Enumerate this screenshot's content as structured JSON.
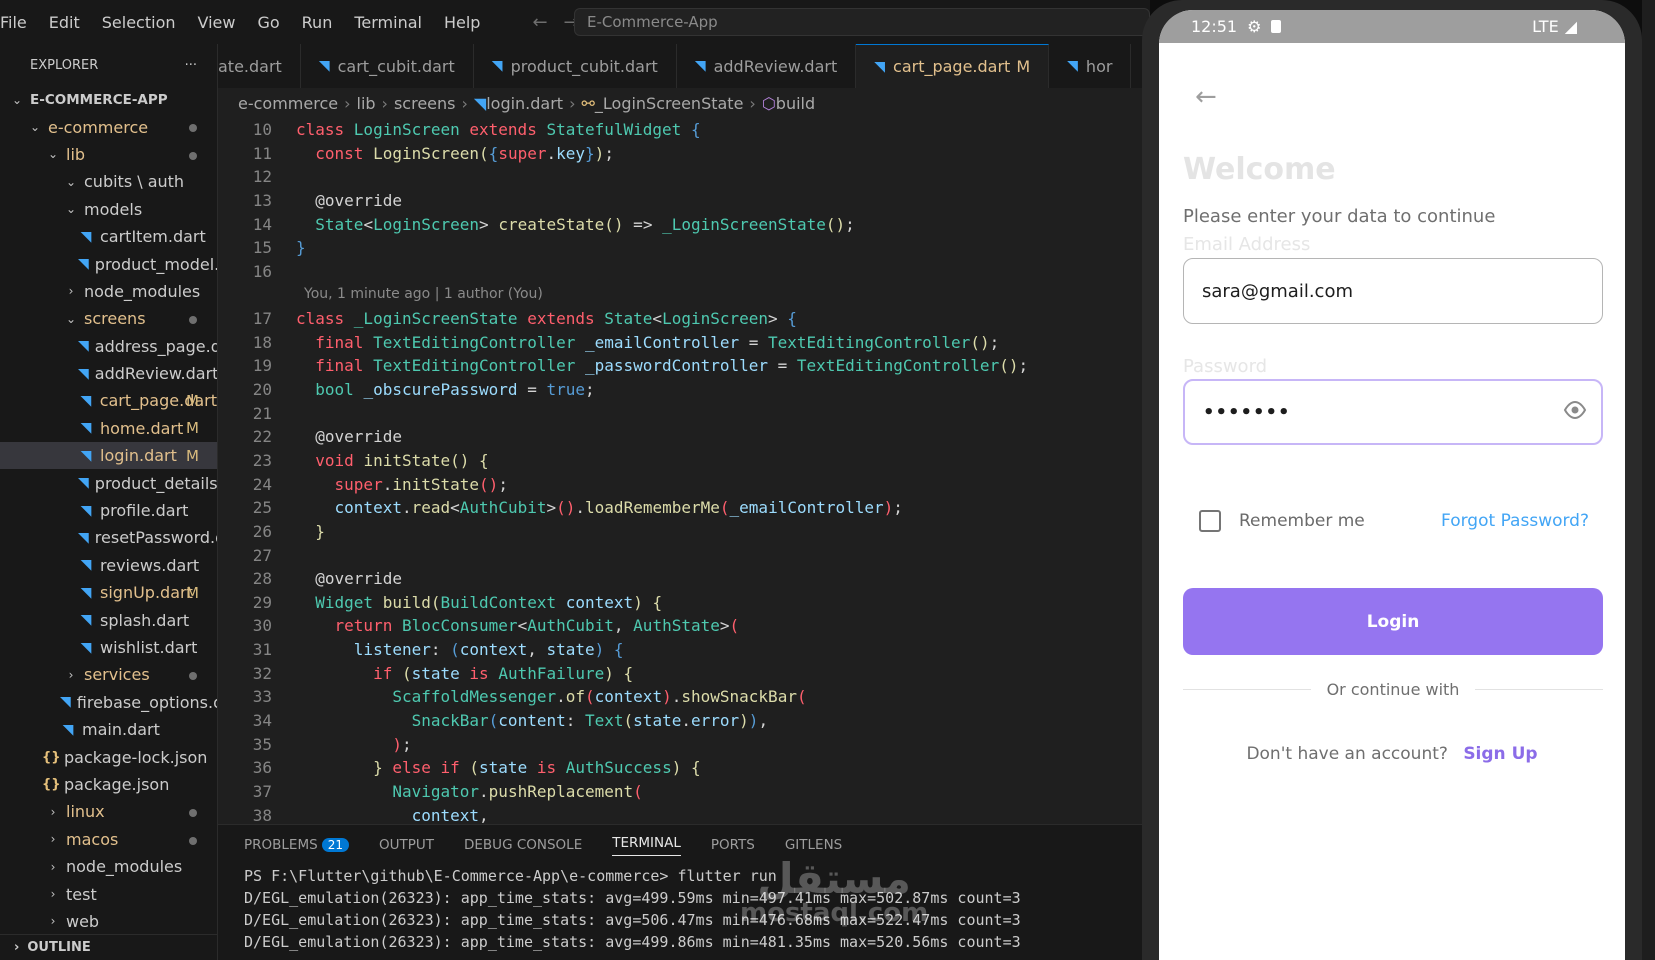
{
  "menubar": {
    "items": [
      "File",
      "Edit",
      "Selection",
      "View",
      "Go",
      "Run",
      "Terminal",
      "Help"
    ],
    "search_text": "E-Commerce-App"
  },
  "sidebar": {
    "header": "EXPLORER",
    "more": "···",
    "tree": [
      {
        "label": "E-COMMERCE-APP",
        "indent": 0,
        "type": "root-open",
        "badge": ""
      },
      {
        "label": "e-commerce",
        "indent": 1,
        "type": "folder-open",
        "badge": "dot",
        "modified": true
      },
      {
        "label": "lib",
        "indent": 2,
        "type": "folder-open",
        "badge": "dot",
        "modified": true
      },
      {
        "label": "cubits \\ auth",
        "indent": 3,
        "type": "folder-open",
        "badge": ""
      },
      {
        "label": "models",
        "indent": 3,
        "type": "folder-open",
        "badge": ""
      },
      {
        "label": "cartItem.dart",
        "indent": 4,
        "type": "dart",
        "badge": ""
      },
      {
        "label": "product_model.dart",
        "indent": 4,
        "type": "dart",
        "badge": ""
      },
      {
        "label": "node_modules",
        "indent": 3,
        "type": "folder-closed",
        "badge": ""
      },
      {
        "label": "screens",
        "indent": 3,
        "type": "folder-open",
        "badge": "dot",
        "modified": true
      },
      {
        "label": "address_page.dart",
        "indent": 4,
        "type": "dart",
        "badge": ""
      },
      {
        "label": "addReview.dart",
        "indent": 4,
        "type": "dart",
        "badge": ""
      },
      {
        "label": "cart_page.dart",
        "indent": 4,
        "type": "dart",
        "badge": "M",
        "modified": true
      },
      {
        "label": "home.dart",
        "indent": 4,
        "type": "dart",
        "badge": "M",
        "modified": true
      },
      {
        "label": "login.dart",
        "indent": 4,
        "type": "dart",
        "badge": "M",
        "modified": true,
        "selected": true
      },
      {
        "label": "product_details.dart",
        "indent": 4,
        "type": "dart",
        "badge": ""
      },
      {
        "label": "profile.dart",
        "indent": 4,
        "type": "dart",
        "badge": ""
      },
      {
        "label": "resetPassword.dart",
        "indent": 4,
        "type": "dart",
        "badge": ""
      },
      {
        "label": "reviews.dart",
        "indent": 4,
        "type": "dart",
        "badge": ""
      },
      {
        "label": "signUp.dart",
        "indent": 4,
        "type": "dart",
        "badge": "M",
        "modified": true
      },
      {
        "label": "splash.dart",
        "indent": 4,
        "type": "dart",
        "badge": ""
      },
      {
        "label": "wishlist.dart",
        "indent": 4,
        "type": "dart",
        "badge": ""
      },
      {
        "label": "services",
        "indent": 3,
        "type": "folder-closed",
        "badge": "dot",
        "modified": true
      },
      {
        "label": "firebase_options.dart",
        "indent": 3,
        "type": "dart",
        "badge": ""
      },
      {
        "label": "main.dart",
        "indent": 3,
        "type": "dart",
        "badge": ""
      },
      {
        "label": "package-lock.json",
        "indent": 2,
        "type": "json",
        "badge": ""
      },
      {
        "label": "package.json",
        "indent": 2,
        "type": "json",
        "badge": ""
      },
      {
        "label": "linux",
        "indent": 2,
        "type": "folder-closed",
        "badge": "dot",
        "modified": true
      },
      {
        "label": "macos",
        "indent": 2,
        "type": "folder-closed",
        "badge": "dot",
        "modified": true
      },
      {
        "label": "node_modules",
        "indent": 2,
        "type": "folder-closed",
        "badge": ""
      },
      {
        "label": "test",
        "indent": 2,
        "type": "folder-closed",
        "badge": ""
      },
      {
        "label": "web",
        "indent": 2,
        "type": "folder-closed",
        "badge": ""
      }
    ],
    "outline_label": "OUTLINE"
  },
  "tabs": [
    {
      "label": "ate.dart",
      "active": false,
      "badge": "",
      "icon": false
    },
    {
      "label": "cart_cubit.dart",
      "active": false,
      "badge": "",
      "icon": true
    },
    {
      "label": "product_cubit.dart",
      "active": false,
      "badge": "",
      "icon": true
    },
    {
      "label": "addReview.dart",
      "active": false,
      "badge": "",
      "icon": true
    },
    {
      "label": "cart_page.dart",
      "active": true,
      "badge": "M",
      "icon": true
    },
    {
      "label": "hor",
      "active": false,
      "badge": "",
      "icon": true
    }
  ],
  "breadcrumb": [
    "e-commerce",
    "lib",
    "screens",
    "login.dart",
    "_LoginScreenState",
    "build"
  ],
  "editor": {
    "blame": "You, 1 minute ago | 1 author (You)",
    "lines": [
      {
        "n": "10",
        "t": [
          [
            "kw",
            "class "
          ],
          [
            "ty",
            "LoginScreen "
          ],
          [
            "kw",
            "extends "
          ],
          [
            "ty",
            "StatefulWidget "
          ],
          [
            "lit",
            "{"
          ]
        ]
      },
      {
        "n": "11",
        "t": [
          [
            "an",
            "  "
          ],
          [
            "kw",
            "const "
          ],
          [
            "fn",
            "LoginScreen"
          ],
          [
            "fn",
            "("
          ],
          [
            "lit",
            "{"
          ],
          [
            "kw",
            "super"
          ],
          [
            "an",
            "."
          ],
          [
            "pr",
            "key"
          ],
          [
            "lit",
            "}"
          ],
          [
            "fn",
            ")"
          ],
          [
            "an",
            ";"
          ]
        ]
      },
      {
        "n": "12",
        "t": []
      },
      {
        "n": "13",
        "t": [
          [
            "an",
            "  @override"
          ]
        ]
      },
      {
        "n": "14",
        "t": [
          [
            "an",
            "  "
          ],
          [
            "ty",
            "State"
          ],
          [
            "an",
            "<"
          ],
          [
            "ty",
            "LoginScreen"
          ],
          [
            "an",
            "> "
          ],
          [
            "fn",
            "createState"
          ],
          [
            "fn",
            "()"
          ],
          [
            "an",
            " => "
          ],
          [
            "ty",
            "_LoginScreenState"
          ],
          [
            "fn",
            "()"
          ],
          [
            "an",
            ";"
          ]
        ]
      },
      {
        "n": "15",
        "t": [
          [
            "lit",
            "}"
          ]
        ]
      },
      {
        "n": "16",
        "t": []
      },
      {
        "n": "blame"
      },
      {
        "n": "17",
        "t": [
          [
            "kw",
            "class "
          ],
          [
            "ty",
            "_LoginScreenState "
          ],
          [
            "kw",
            "extends "
          ],
          [
            "ty",
            "State"
          ],
          [
            "an",
            "<"
          ],
          [
            "ty",
            "LoginScreen"
          ],
          [
            "an",
            "> "
          ],
          [
            "lit",
            "{"
          ]
        ]
      },
      {
        "n": "18",
        "t": [
          [
            "an",
            "  "
          ],
          [
            "kw",
            "final "
          ],
          [
            "ty",
            "TextEditingController "
          ],
          [
            "pr",
            "_emailController "
          ],
          [
            "an",
            "= "
          ],
          [
            "ty",
            "TextEditingController"
          ],
          [
            "fn",
            "()"
          ],
          [
            "an",
            ";"
          ]
        ]
      },
      {
        "n": "19",
        "t": [
          [
            "an",
            "  "
          ],
          [
            "kw",
            "final "
          ],
          [
            "ty",
            "TextEditingController "
          ],
          [
            "pr",
            "_passwordController "
          ],
          [
            "an",
            "= "
          ],
          [
            "ty",
            "TextEditingController"
          ],
          [
            "fn",
            "()"
          ],
          [
            "an",
            ";"
          ]
        ]
      },
      {
        "n": "20",
        "t": [
          [
            "an",
            "  "
          ],
          [
            "ty",
            "bool "
          ],
          [
            "pr",
            "_obscurePassword "
          ],
          [
            "an",
            "= "
          ],
          [
            "lit",
            "true"
          ],
          [
            "an",
            ";"
          ]
        ]
      },
      {
        "n": "21",
        "t": []
      },
      {
        "n": "22",
        "t": [
          [
            "an",
            "  @override"
          ]
        ]
      },
      {
        "n": "23",
        "t": [
          [
            "an",
            "  "
          ],
          [
            "kw",
            "void "
          ],
          [
            "fn",
            "initState"
          ],
          [
            "fn",
            "() "
          ],
          [
            "fn",
            "{"
          ]
        ]
      },
      {
        "n": "24",
        "t": [
          [
            "an",
            "    "
          ],
          [
            "kw",
            "super"
          ],
          [
            "an",
            "."
          ],
          [
            "fn",
            "initState"
          ],
          [
            "kw",
            "()"
          ],
          [
            "an",
            ";"
          ]
        ]
      },
      {
        "n": "25",
        "t": [
          [
            "an",
            "    "
          ],
          [
            "pr",
            "context"
          ],
          [
            "an",
            "."
          ],
          [
            "fn",
            "read"
          ],
          [
            "an",
            "<"
          ],
          [
            "ty",
            "AuthCubit"
          ],
          [
            "an",
            ">"
          ],
          [
            "kw",
            "()"
          ],
          [
            "an",
            "."
          ],
          [
            "fn",
            "loadRememberMe"
          ],
          [
            "kw",
            "("
          ],
          [
            "pr",
            "_emailController"
          ],
          [
            "kw",
            ")"
          ],
          [
            "an",
            ";"
          ]
        ]
      },
      {
        "n": "26",
        "t": [
          [
            "an",
            "  "
          ],
          [
            "fn",
            "}"
          ]
        ]
      },
      {
        "n": "27",
        "t": []
      },
      {
        "n": "28",
        "t": [
          [
            "an",
            "  @override"
          ]
        ]
      },
      {
        "n": "29",
        "t": [
          [
            "an",
            "  "
          ],
          [
            "ty",
            "Widget "
          ],
          [
            "fn",
            "build"
          ],
          [
            "fn",
            "("
          ],
          [
            "ty",
            "BuildContext "
          ],
          [
            "pr",
            "context"
          ],
          [
            "fn",
            ") {"
          ]
        ]
      },
      {
        "n": "30",
        "t": [
          [
            "an",
            "    "
          ],
          [
            "kw",
            "return "
          ],
          [
            "ty",
            "BlocConsumer"
          ],
          [
            "an",
            "<"
          ],
          [
            "ty",
            "AuthCubit"
          ],
          [
            "an",
            ", "
          ],
          [
            "ty",
            "AuthState"
          ],
          [
            "an",
            ">"
          ],
          [
            "kw",
            "("
          ]
        ]
      },
      {
        "n": "31",
        "t": [
          [
            "an",
            "      "
          ],
          [
            "pr",
            "listener"
          ],
          [
            "an",
            ": "
          ],
          [
            "lit",
            "("
          ],
          [
            "pr",
            "context"
          ],
          [
            "an",
            ", "
          ],
          [
            "pr",
            "state"
          ],
          [
            "lit",
            ") {"
          ]
        ]
      },
      {
        "n": "32",
        "t": [
          [
            "an",
            "        "
          ],
          [
            "kw",
            "if "
          ],
          [
            "fn",
            "("
          ],
          [
            "pr",
            "state "
          ],
          [
            "kw",
            "is "
          ],
          [
            "ty",
            "AuthFailure"
          ],
          [
            "fn",
            ") {"
          ]
        ]
      },
      {
        "n": "33",
        "t": [
          [
            "an",
            "          "
          ],
          [
            "ty",
            "ScaffoldMessenger"
          ],
          [
            "an",
            "."
          ],
          [
            "fn",
            "of"
          ],
          [
            "kw",
            "("
          ],
          [
            "pr",
            "context"
          ],
          [
            "kw",
            ")"
          ],
          [
            "an",
            "."
          ],
          [
            "fn",
            "showSnackBar"
          ],
          [
            "kw",
            "("
          ]
        ]
      },
      {
        "n": "34",
        "t": [
          [
            "an",
            "            "
          ],
          [
            "ty",
            "SnackBar"
          ],
          [
            "lit",
            "("
          ],
          [
            "pr",
            "content"
          ],
          [
            "an",
            ": "
          ],
          [
            "ty",
            "Text"
          ],
          [
            "fn",
            "("
          ],
          [
            "pr",
            "state"
          ],
          [
            "an",
            "."
          ],
          [
            "pr",
            "error"
          ],
          [
            "fn",
            ")"
          ],
          [
            "lit",
            ")"
          ],
          [
            "an",
            ","
          ]
        ]
      },
      {
        "n": "35",
        "t": [
          [
            "an",
            "          "
          ],
          [
            "kw",
            ")"
          ],
          [
            "an",
            ";"
          ]
        ]
      },
      {
        "n": "36",
        "t": [
          [
            "an",
            "        "
          ],
          [
            "fn",
            "} "
          ],
          [
            "kw",
            "else if "
          ],
          [
            "fn",
            "("
          ],
          [
            "pr",
            "state "
          ],
          [
            "kw",
            "is "
          ],
          [
            "ty",
            "AuthSuccess"
          ],
          [
            "fn",
            ") {"
          ]
        ]
      },
      {
        "n": "37",
        "t": [
          [
            "an",
            "          "
          ],
          [
            "ty",
            "Navigator"
          ],
          [
            "an",
            "."
          ],
          [
            "fn",
            "pushReplacement"
          ],
          [
            "kw",
            "("
          ]
        ]
      },
      {
        "n": "38",
        "t": [
          [
            "an",
            "            "
          ],
          [
            "pr",
            "context"
          ],
          [
            "an",
            ","
          ]
        ]
      }
    ]
  },
  "panel": {
    "tabs": [
      "PROBLEMS",
      "OUTPUT",
      "DEBUG CONSOLE",
      "TERMINAL",
      "PORTS",
      "GITLENS"
    ],
    "problems_count": "21",
    "active_tab": "TERMINAL",
    "terminal_lines": [
      "PS F:\\Flutter\\github\\E-Commerce-App\\e-commerce> flutter run",
      "D/EGL_emulation(26323): app_time_stats: avg=499.59ms min=497.41ms max=502.87ms count=3",
      "D/EGL_emulation(26323): app_time_stats: avg=506.47ms min=476.68ms max=522.47ms count=3",
      "D/EGL_emulation(26323): app_time_stats: avg=499.86ms min=481.35ms max=520.56ms count=3"
    ]
  },
  "watermark": {
    "arabic": "مستقل",
    "latin": "mostaql.com"
  },
  "phone": {
    "time": "12:51",
    "network": "LTE",
    "title": "Welcome",
    "subtitle": "Please enter your data to continue",
    "email_label": "Email Address",
    "email_value": "sara@gmail.com",
    "password_label": "Password",
    "password_value": "•••••••",
    "remember_label": "Remember me",
    "forgot_label": "Forgot Password?",
    "login_label": "Login",
    "divider_text": "Or continue with",
    "no_account": "Don't have an account?",
    "signup_label": "Sign Up",
    "colors": {
      "primary": "#9575f0",
      "link": "#42a5f5",
      "signup": "#8b6ce8"
    }
  }
}
